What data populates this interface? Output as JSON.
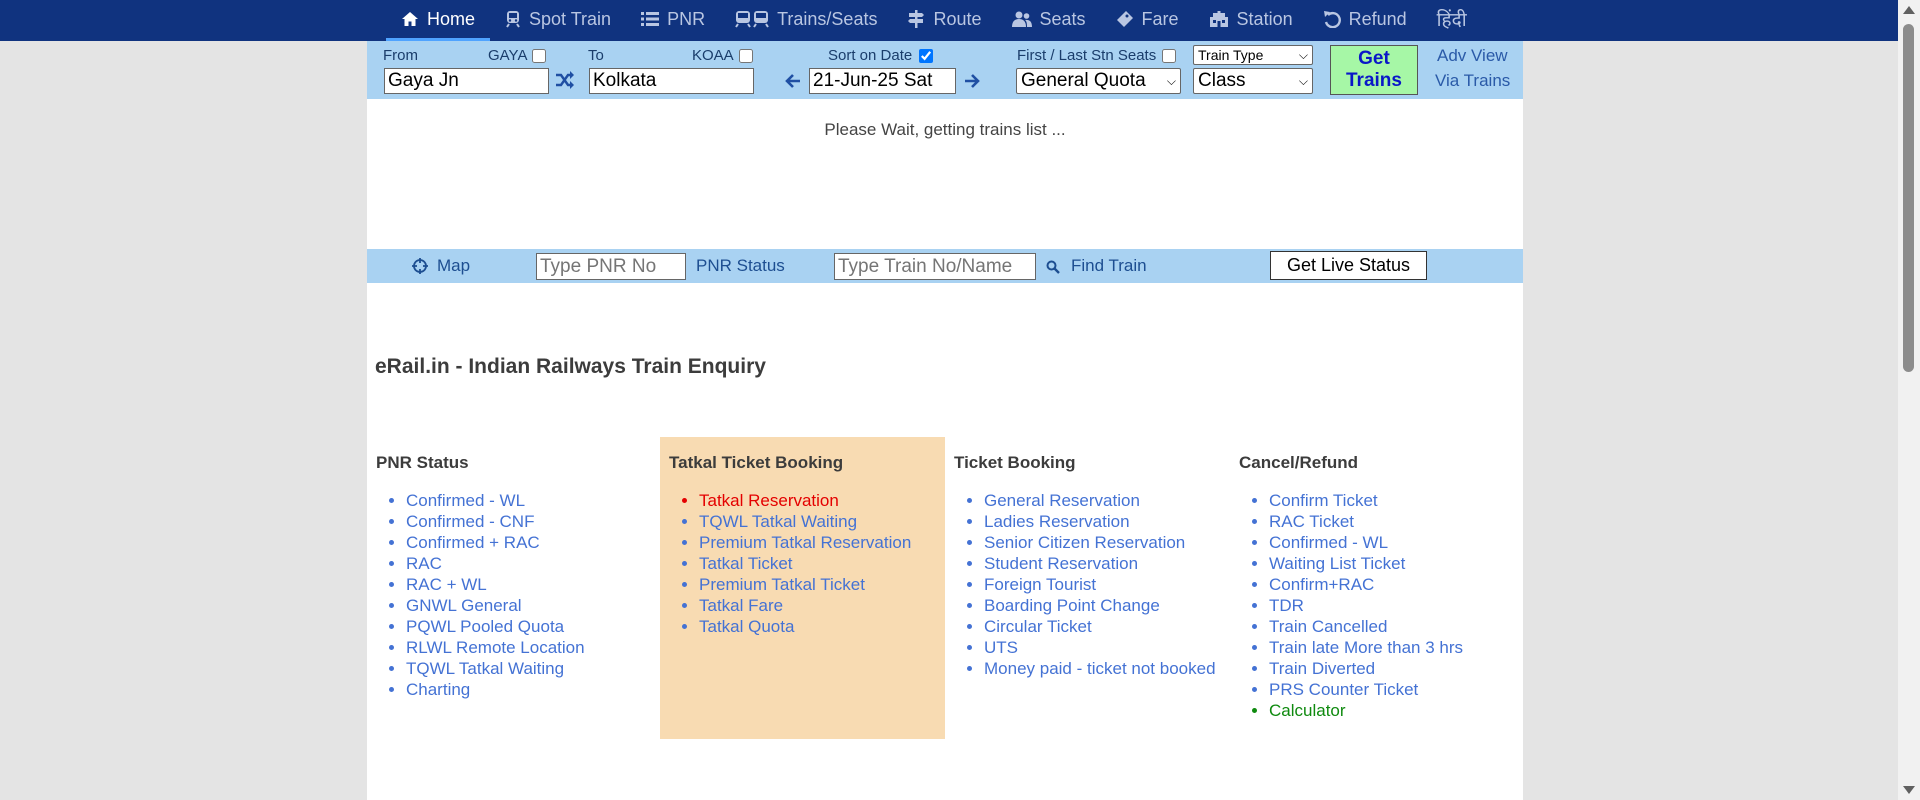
{
  "nav": {
    "items": [
      {
        "label": "Home",
        "icon": "home-icon"
      },
      {
        "label": "Spot Train",
        "icon": "train-icon"
      },
      {
        "label": "PNR",
        "icon": "list-icon"
      },
      {
        "label": "Trains/Seats",
        "icon": "trains-icon"
      },
      {
        "label": "Route",
        "icon": "signpost-icon"
      },
      {
        "label": "Seats",
        "icon": "users-icon"
      },
      {
        "label": "Fare",
        "icon": "ticket-icon"
      },
      {
        "label": "Station",
        "icon": "station-icon"
      },
      {
        "label": "Refund",
        "icon": "undo-icon"
      },
      {
        "label": "हिंदी",
        "icon": ""
      }
    ]
  },
  "search": {
    "from_label": "From",
    "from_code": "GAYA",
    "from_value": "Gaya Jn",
    "to_label": "To",
    "to_code": "KOAA",
    "to_value": "Kolkata",
    "sort_label": "Sort on Date",
    "date_value": "21-Jun-25 Sat",
    "first_last_label": "First / Last Stn Seats",
    "train_type": "Train Type",
    "quota": "General Quota",
    "class": "Class",
    "get_trains_line1": "Get",
    "get_trains_line2": "Trains",
    "adv_view": "Adv View",
    "via_trains": "Via Trains"
  },
  "status": {
    "wait": "Please Wait, getting trains list ..."
  },
  "bar2": {
    "map": "Map",
    "pnr_placeholder": "Type PNR No",
    "pnr_status": "PNR Status",
    "train_placeholder": "Type Train No/Name",
    "find_train": "Find Train",
    "live_status": "Get Live Status"
  },
  "title": "eRail.in - Indian Railways Train Enquiry",
  "columns": [
    {
      "heading": "PNR Status",
      "items": [
        "Confirmed - WL",
        "Confirmed - CNF",
        "Confirmed + RAC",
        "RAC",
        "RAC + WL",
        "GNWL General",
        "PQWL Pooled Quota",
        "RLWL Remote Location",
        "TQWL Tatkal Waiting",
        "Charting"
      ]
    },
    {
      "heading": "Tatkal Ticket Booking",
      "items": [
        "Tatkal Reservation",
        "TQWL Tatkal Waiting",
        "Premium Tatkal Reservation",
        "Tatkal Ticket",
        "Premium Tatkal Ticket",
        "Tatkal Fare",
        "Tatkal Quota"
      ]
    },
    {
      "heading": "Ticket Booking",
      "items": [
        "General Reservation",
        "Ladies Reservation",
        "Senior Citizen Reservation",
        "Student Reservation",
        "Foreign Tourist",
        "Boarding Point Change",
        "Circular Ticket",
        "UTS",
        "Money paid - ticket not booked"
      ]
    },
    {
      "heading": "Cancel/Refund",
      "items": [
        "Confirm Ticket",
        "RAC Ticket",
        "Confirmed - WL",
        "Waiting List Ticket",
        "Confirm+RAC",
        "TDR",
        "Train Cancelled",
        "Train late More than 3 hrs",
        "Train Diverted",
        "PRS Counter Ticket",
        "Calculator"
      ]
    }
  ],
  "colors": {
    "nav_bg": "#10337f",
    "panel_bg": "#a9d2f2",
    "tatkal_bg": "#f8dbb2",
    "link": "#4472d4",
    "highlight_red": "#e40000",
    "highlight_green": "#0f8a0f",
    "get_trains_bg": "#a6f7a6"
  }
}
